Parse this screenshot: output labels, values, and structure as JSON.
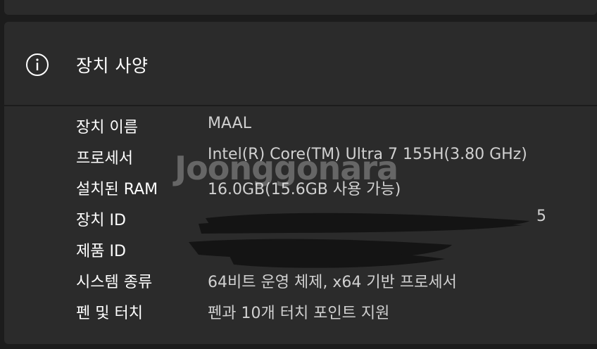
{
  "spec_section": {
    "title": "장치 사양",
    "icon": "info-icon"
  },
  "specs": [
    {
      "label": "장치 이름",
      "value": "MAAL"
    },
    {
      "label": "프로세서",
      "value": "Intel(R) Core(TM) Ultra 7 155H(3.80 GHz)"
    },
    {
      "label": "설치된 RAM",
      "value": "16.0GB(15.6GB 사용 가능)"
    },
    {
      "label": "장치 ID",
      "value": "5"
    },
    {
      "label": "제품 ID",
      "value": ""
    },
    {
      "label": "시스템 종류",
      "value": "64비트 운영 체제, x64 기반 프로세서"
    },
    {
      "label": "펜 및 터치",
      "value": "펜과 10개 터치 포인트 지원"
    }
  ],
  "watermark": "Joonggonara",
  "colors": {
    "background": "#1c1c1c",
    "card": "#2b2b2b",
    "label_text": "#ffffff",
    "value_text": "#d0d0d0",
    "redaction": "#141414"
  }
}
